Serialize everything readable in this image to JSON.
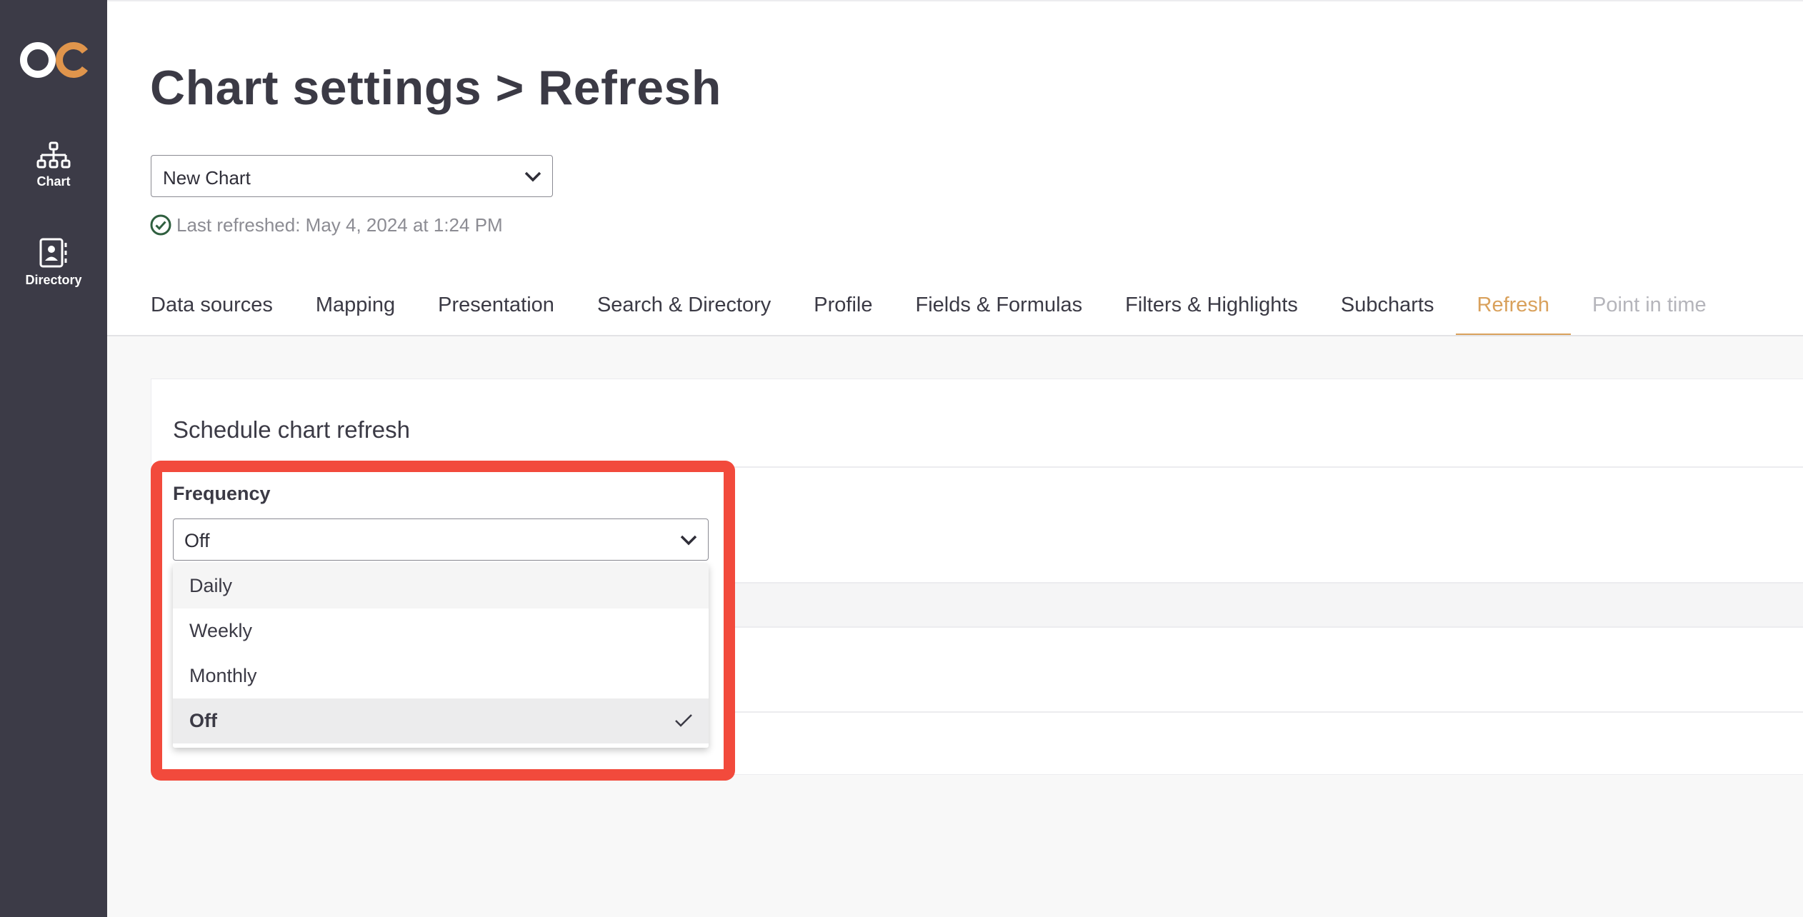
{
  "app": {
    "logo_icon": "oc-logo",
    "colors": {
      "sidebar_bg": "#3c3b47",
      "accent": "#d9a15c",
      "highlight": "#f24a3c",
      "success": "#2f7d4f"
    }
  },
  "sidebar": {
    "items": [
      {
        "label": "Chart",
        "icon": "org-chart-icon"
      },
      {
        "label": "Directory",
        "icon": "contact-book-icon"
      }
    ]
  },
  "header": {
    "title": "Chart settings > Refresh",
    "chart_selector": {
      "value": "New Chart"
    },
    "last_refreshed": "Last refreshed: May 4, 2024 at 1:24 PM"
  },
  "tabs": [
    {
      "label": "Data sources"
    },
    {
      "label": "Mapping"
    },
    {
      "label": "Presentation"
    },
    {
      "label": "Search & Directory"
    },
    {
      "label": "Profile"
    },
    {
      "label": "Fields & Formulas"
    },
    {
      "label": "Filters & Highlights"
    },
    {
      "label": "Subcharts"
    },
    {
      "label": "Refresh",
      "active": true
    },
    {
      "label": "Point in time",
      "disabled": true
    }
  ],
  "schedule": {
    "title": "Schedule chart refresh",
    "frequency_label": "Frequency",
    "frequency_value": "Off",
    "options": [
      {
        "label": "Daily"
      },
      {
        "label": "Weekly"
      },
      {
        "label": "Monthly"
      },
      {
        "label": "Off",
        "selected": true
      }
    ]
  }
}
